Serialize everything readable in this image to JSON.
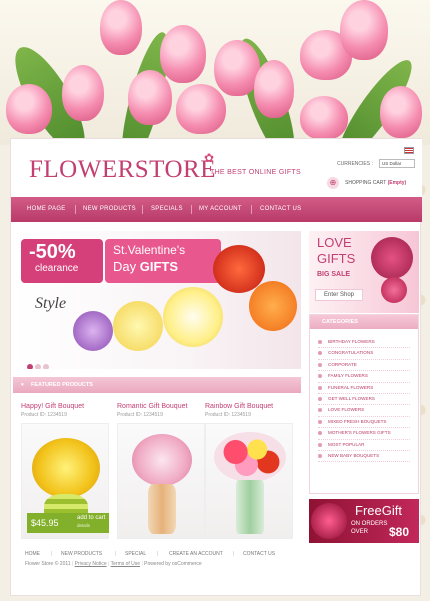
{
  "header": {
    "logo": "FLOWERSTORE",
    "tagline": "THE BEST ONLINE GIFTS",
    "currencies_label": "CURRENCIES :",
    "currency_value": "US Dollar",
    "cart_label": "SHOPPING CART",
    "cart_status": "(Empty)"
  },
  "nav": {
    "items": [
      "HOME PAGE",
      "NEW PRODUCTS",
      "SPECIALS",
      "MY ACCOUNT",
      "CONTACT US"
    ]
  },
  "banner": {
    "discount": "-50%",
    "clearance": "clearance",
    "line1": "St.Valentine's",
    "line2_prefix": "Day",
    "line2_bold": "GIFTS",
    "style_text": "Style"
  },
  "promo_love": {
    "line1": "LOVE",
    "line2": "GIFTS",
    "big_sale": "BIG SALE",
    "button": "Enter Shop"
  },
  "categories": {
    "title": "CATEGORIES",
    "items": [
      "BIRTHDAY FLOWERS",
      "CONGRATULATIONS",
      "CORPORATE",
      "FAMILY FLOWERS",
      "FUNERAL FLOWERS",
      "GET WELL FLOWERS",
      "LOVE FLOWERS",
      "MIXED FRESH BOUQUETS",
      "MOTHER'S FLOWERS GIFTS",
      "MOST POPULAR",
      "NEW BABY BOUQUETS"
    ]
  },
  "freegift": {
    "title": "FreeGift",
    "line1": "ON ORDERS",
    "line2": "OVER",
    "amount": "$80"
  },
  "featured": {
    "title": "FEATURED PRODUCTS",
    "products": [
      {
        "name": "Happy! Gift Bouquet",
        "id": "Product ID: 1234519",
        "price": "$45.95",
        "add_label": "add to cart",
        "details_label": "details"
      },
      {
        "name": "Romantic Gift Bouquet",
        "id": "Product ID: 1234519"
      },
      {
        "name": "Rainbow Gift Bouquet",
        "id": "Product ID: 1234519"
      }
    ]
  },
  "footer": {
    "links": [
      "HOME",
      "NEW PRODUCTS",
      "SPECIAL",
      "CREATE AN ACCOUNT",
      "CONTACT US"
    ],
    "copyright": "Flower Store © 2011",
    "privacy": "Privacy Notice",
    "terms": "Terms of Use",
    "powered": "Powered by osCommerce"
  },
  "colors": {
    "brand_pink": "#c23f72",
    "nav_pink": "#b83a68",
    "price_green": "#83b02b"
  }
}
